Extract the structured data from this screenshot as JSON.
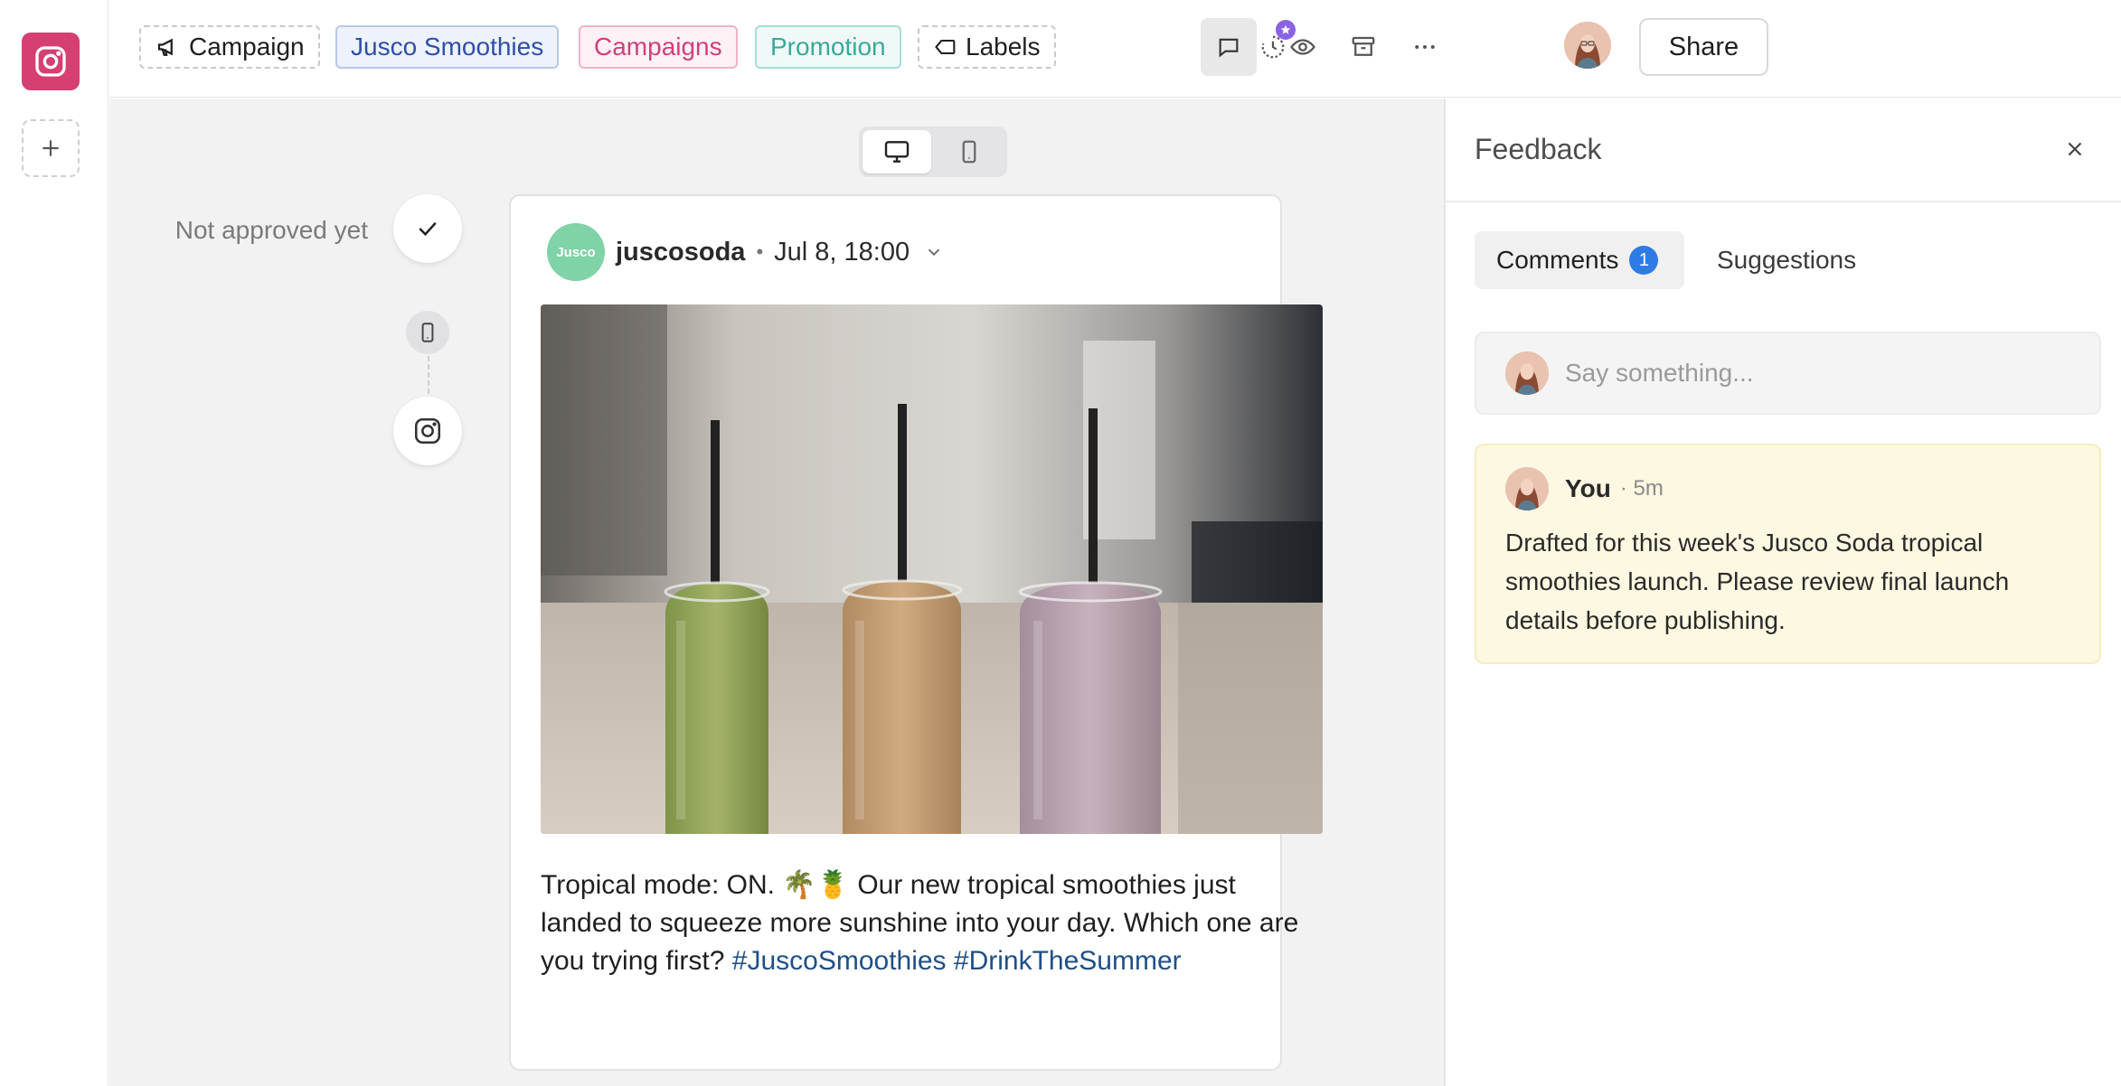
{
  "header": {
    "chips": {
      "campaign": "Campaign",
      "jusco_smoothies": "Jusco Smoothies",
      "campaigns": "Campaigns",
      "promotion": "Promotion",
      "labels": "Labels"
    },
    "share_label": "Share"
  },
  "approval": {
    "status_text": "Not approved yet"
  },
  "post": {
    "handle": "juscosoda",
    "logo_text": "Jusco",
    "separator": "•",
    "date": "Jul 8, 18:00",
    "caption_text": "Tropical mode: ON. 🌴🍍 Our new tropical smoothies just landed to squeeze more sunshine into your day. Which one are you trying first?",
    "hashtag_1": "#JuscoSmoothies",
    "hashtag_2": "#DrinkTheSummer"
  },
  "feedback": {
    "title": "Feedback",
    "tabs": {
      "comments_label": "Comments",
      "comments_count": "1",
      "suggestions_label": "Suggestions"
    },
    "input_placeholder": "Say something...",
    "comment": {
      "author": "You",
      "time": "· 5m",
      "body": "Drafted for this week's Jusco Soda tropical smoothies launch. Please review final launch details before publishing."
    }
  },
  "colors": {
    "instagram": "#d63f72",
    "accent_blue": "#2f7be5",
    "comment_bg": "#fdf8e1",
    "hashtag": "#1f4f87"
  }
}
